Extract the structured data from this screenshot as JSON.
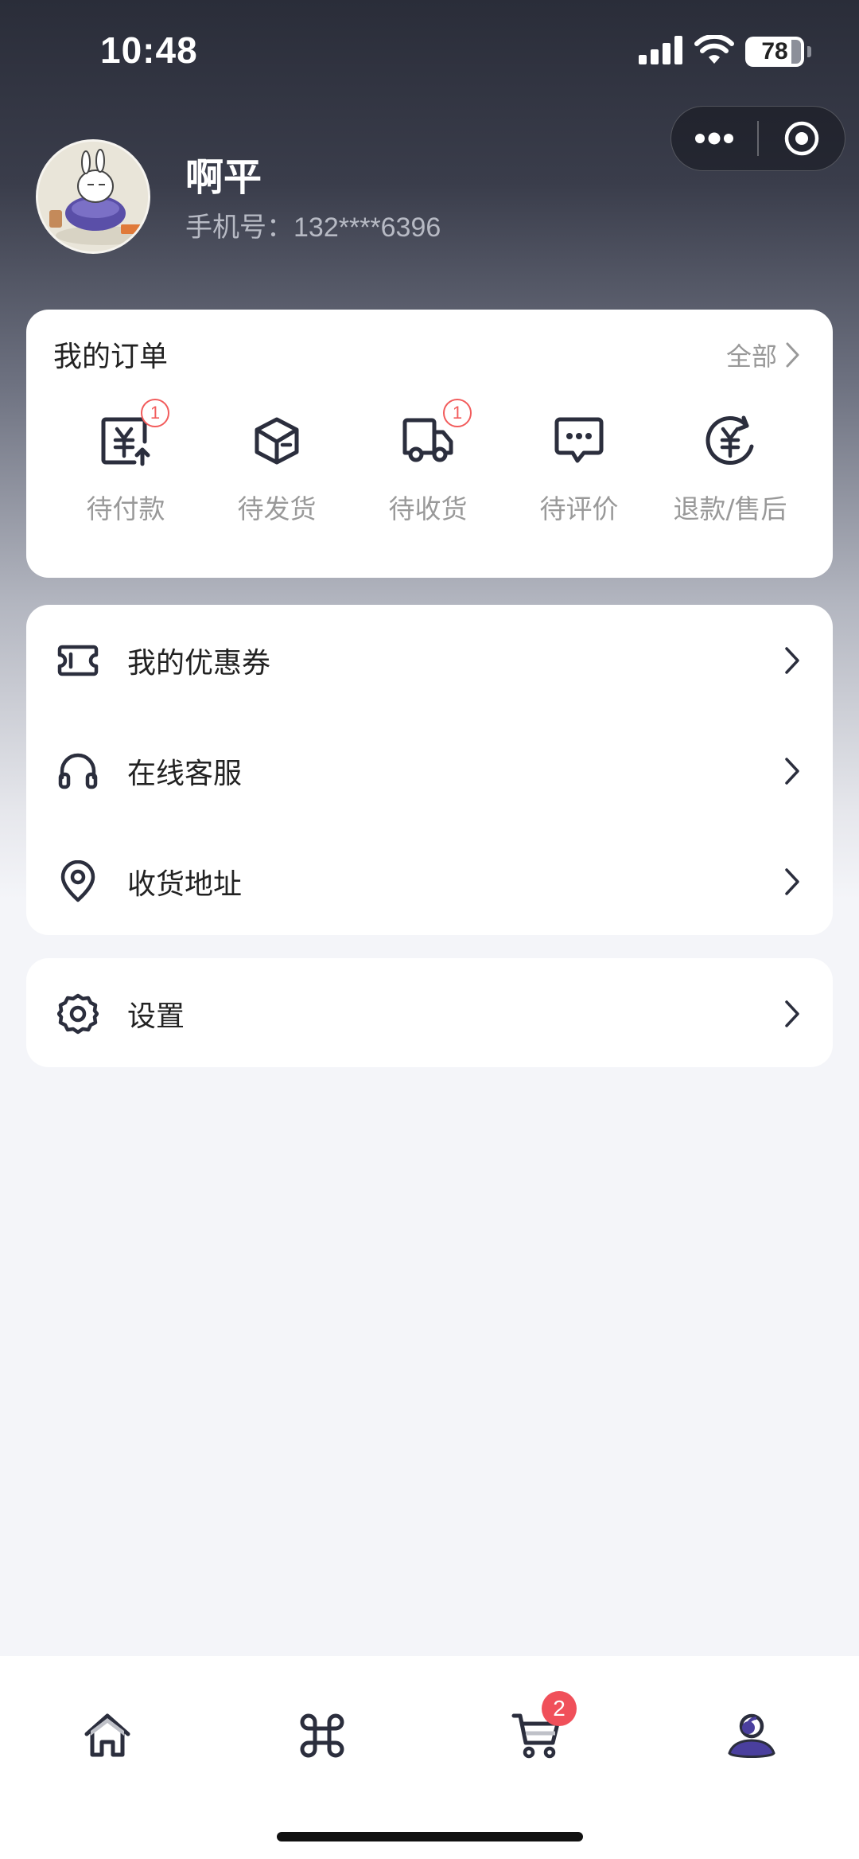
{
  "status_bar": {
    "time": "10:48",
    "battery": "78"
  },
  "profile": {
    "name": "啊平",
    "phone": "手机号：132****6396"
  },
  "orders": {
    "title": "我的订单",
    "all_label": "全部",
    "items": [
      {
        "label": "待付款",
        "icon": "pending-payment-icon",
        "badge": "1"
      },
      {
        "label": "待发货",
        "icon": "package-icon",
        "badge": ""
      },
      {
        "label": "待收货",
        "icon": "delivery-truck-icon",
        "badge": "1"
      },
      {
        "label": "待评价",
        "icon": "comment-icon",
        "badge": ""
      },
      {
        "label": "退款/售后",
        "icon": "refund-icon",
        "badge": ""
      }
    ]
  },
  "menu": [
    {
      "label": "我的优惠券",
      "icon": "coupon-icon"
    },
    {
      "label": "在线客服",
      "icon": "headset-icon"
    },
    {
      "label": "收货地址",
      "icon": "location-pin-icon"
    }
  ],
  "settings": {
    "label": "设置",
    "icon": "gear-icon"
  },
  "tab_bar": {
    "tabs": [
      {
        "name": "home",
        "icon": "home-icon"
      },
      {
        "name": "category",
        "icon": "category-icon"
      },
      {
        "name": "cart",
        "icon": "cart-icon",
        "badge": "2"
      },
      {
        "name": "profile",
        "icon": "user-icon",
        "active": true
      }
    ]
  },
  "colors": {
    "accent": "#4a3f9e",
    "badge": "#f25c5c",
    "header_dark": "#2a2d39"
  }
}
